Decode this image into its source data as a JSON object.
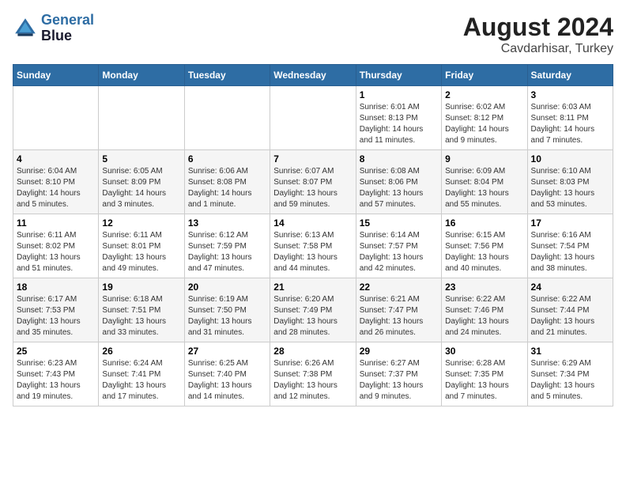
{
  "logo": {
    "line1": "General",
    "line2": "Blue"
  },
  "title": "August 2024",
  "subtitle": "Cavdarhisar, Turkey",
  "days_of_week": [
    "Sunday",
    "Monday",
    "Tuesday",
    "Wednesday",
    "Thursday",
    "Friday",
    "Saturday"
  ],
  "weeks": [
    [
      {
        "num": "",
        "info": ""
      },
      {
        "num": "",
        "info": ""
      },
      {
        "num": "",
        "info": ""
      },
      {
        "num": "",
        "info": ""
      },
      {
        "num": "1",
        "info": "Sunrise: 6:01 AM\nSunset: 8:13 PM\nDaylight: 14 hours\nand 11 minutes."
      },
      {
        "num": "2",
        "info": "Sunrise: 6:02 AM\nSunset: 8:12 PM\nDaylight: 14 hours\nand 9 minutes."
      },
      {
        "num": "3",
        "info": "Sunrise: 6:03 AM\nSunset: 8:11 PM\nDaylight: 14 hours\nand 7 minutes."
      }
    ],
    [
      {
        "num": "4",
        "info": "Sunrise: 6:04 AM\nSunset: 8:10 PM\nDaylight: 14 hours\nand 5 minutes."
      },
      {
        "num": "5",
        "info": "Sunrise: 6:05 AM\nSunset: 8:09 PM\nDaylight: 14 hours\nand 3 minutes."
      },
      {
        "num": "6",
        "info": "Sunrise: 6:06 AM\nSunset: 8:08 PM\nDaylight: 14 hours\nand 1 minute."
      },
      {
        "num": "7",
        "info": "Sunrise: 6:07 AM\nSunset: 8:07 PM\nDaylight: 13 hours\nand 59 minutes."
      },
      {
        "num": "8",
        "info": "Sunrise: 6:08 AM\nSunset: 8:06 PM\nDaylight: 13 hours\nand 57 minutes."
      },
      {
        "num": "9",
        "info": "Sunrise: 6:09 AM\nSunset: 8:04 PM\nDaylight: 13 hours\nand 55 minutes."
      },
      {
        "num": "10",
        "info": "Sunrise: 6:10 AM\nSunset: 8:03 PM\nDaylight: 13 hours\nand 53 minutes."
      }
    ],
    [
      {
        "num": "11",
        "info": "Sunrise: 6:11 AM\nSunset: 8:02 PM\nDaylight: 13 hours\nand 51 minutes."
      },
      {
        "num": "12",
        "info": "Sunrise: 6:11 AM\nSunset: 8:01 PM\nDaylight: 13 hours\nand 49 minutes."
      },
      {
        "num": "13",
        "info": "Sunrise: 6:12 AM\nSunset: 7:59 PM\nDaylight: 13 hours\nand 47 minutes."
      },
      {
        "num": "14",
        "info": "Sunrise: 6:13 AM\nSunset: 7:58 PM\nDaylight: 13 hours\nand 44 minutes."
      },
      {
        "num": "15",
        "info": "Sunrise: 6:14 AM\nSunset: 7:57 PM\nDaylight: 13 hours\nand 42 minutes."
      },
      {
        "num": "16",
        "info": "Sunrise: 6:15 AM\nSunset: 7:56 PM\nDaylight: 13 hours\nand 40 minutes."
      },
      {
        "num": "17",
        "info": "Sunrise: 6:16 AM\nSunset: 7:54 PM\nDaylight: 13 hours\nand 38 minutes."
      }
    ],
    [
      {
        "num": "18",
        "info": "Sunrise: 6:17 AM\nSunset: 7:53 PM\nDaylight: 13 hours\nand 35 minutes."
      },
      {
        "num": "19",
        "info": "Sunrise: 6:18 AM\nSunset: 7:51 PM\nDaylight: 13 hours\nand 33 minutes."
      },
      {
        "num": "20",
        "info": "Sunrise: 6:19 AM\nSunset: 7:50 PM\nDaylight: 13 hours\nand 31 minutes."
      },
      {
        "num": "21",
        "info": "Sunrise: 6:20 AM\nSunset: 7:49 PM\nDaylight: 13 hours\nand 28 minutes."
      },
      {
        "num": "22",
        "info": "Sunrise: 6:21 AM\nSunset: 7:47 PM\nDaylight: 13 hours\nand 26 minutes."
      },
      {
        "num": "23",
        "info": "Sunrise: 6:22 AM\nSunset: 7:46 PM\nDaylight: 13 hours\nand 24 minutes."
      },
      {
        "num": "24",
        "info": "Sunrise: 6:22 AM\nSunset: 7:44 PM\nDaylight: 13 hours\nand 21 minutes."
      }
    ],
    [
      {
        "num": "25",
        "info": "Sunrise: 6:23 AM\nSunset: 7:43 PM\nDaylight: 13 hours\nand 19 minutes."
      },
      {
        "num": "26",
        "info": "Sunrise: 6:24 AM\nSunset: 7:41 PM\nDaylight: 13 hours\nand 17 minutes."
      },
      {
        "num": "27",
        "info": "Sunrise: 6:25 AM\nSunset: 7:40 PM\nDaylight: 13 hours\nand 14 minutes."
      },
      {
        "num": "28",
        "info": "Sunrise: 6:26 AM\nSunset: 7:38 PM\nDaylight: 13 hours\nand 12 minutes."
      },
      {
        "num": "29",
        "info": "Sunrise: 6:27 AM\nSunset: 7:37 PM\nDaylight: 13 hours\nand 9 minutes."
      },
      {
        "num": "30",
        "info": "Sunrise: 6:28 AM\nSunset: 7:35 PM\nDaylight: 13 hours\nand 7 minutes."
      },
      {
        "num": "31",
        "info": "Sunrise: 6:29 AM\nSunset: 7:34 PM\nDaylight: 13 hours\nand 5 minutes."
      }
    ]
  ]
}
